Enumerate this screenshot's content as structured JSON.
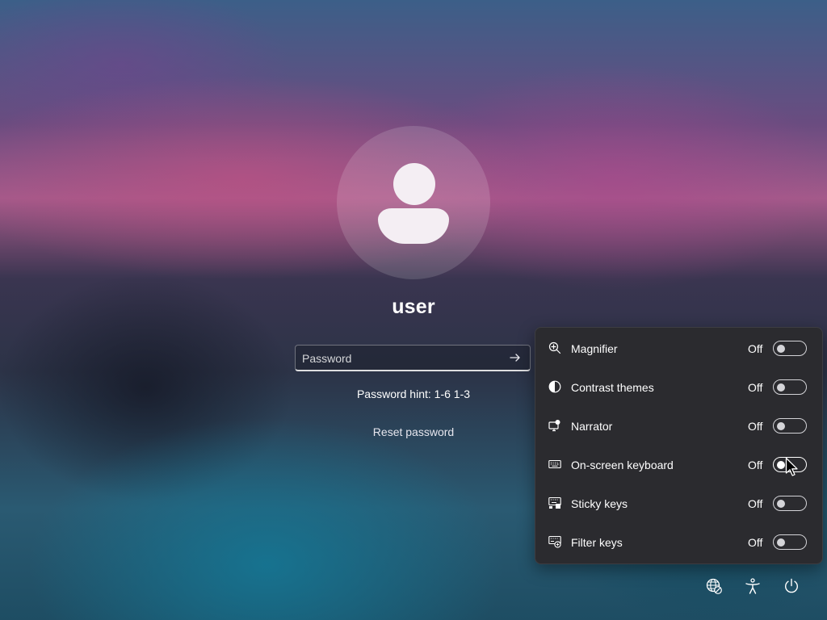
{
  "user": {
    "name": "user"
  },
  "password": {
    "placeholder": "Password",
    "value": "",
    "hint": "Password hint: 1-6 1-3",
    "reset_label": "Reset password"
  },
  "accessibility": {
    "items": [
      {
        "label": "Magnifier",
        "state": "Off",
        "icon": "magnifier-icon"
      },
      {
        "label": "Contrast themes",
        "state": "Off",
        "icon": "contrast-icon"
      },
      {
        "label": "Narrator",
        "state": "Off",
        "icon": "narrator-icon"
      },
      {
        "label": "On-screen keyboard",
        "state": "Off",
        "icon": "keyboard-icon"
      },
      {
        "label": "Sticky keys",
        "state": "Off",
        "icon": "sticky-keys-icon"
      },
      {
        "label": "Filter keys",
        "state": "Off",
        "icon": "filter-keys-icon"
      }
    ]
  },
  "tray": {
    "icons": [
      "network-icon",
      "accessibility-icon",
      "power-icon"
    ]
  },
  "colors": {
    "flyout_bg": "#2b2b2f",
    "toggle_off": "#d4d4d8",
    "avatar_fg": "#f4eef3"
  }
}
